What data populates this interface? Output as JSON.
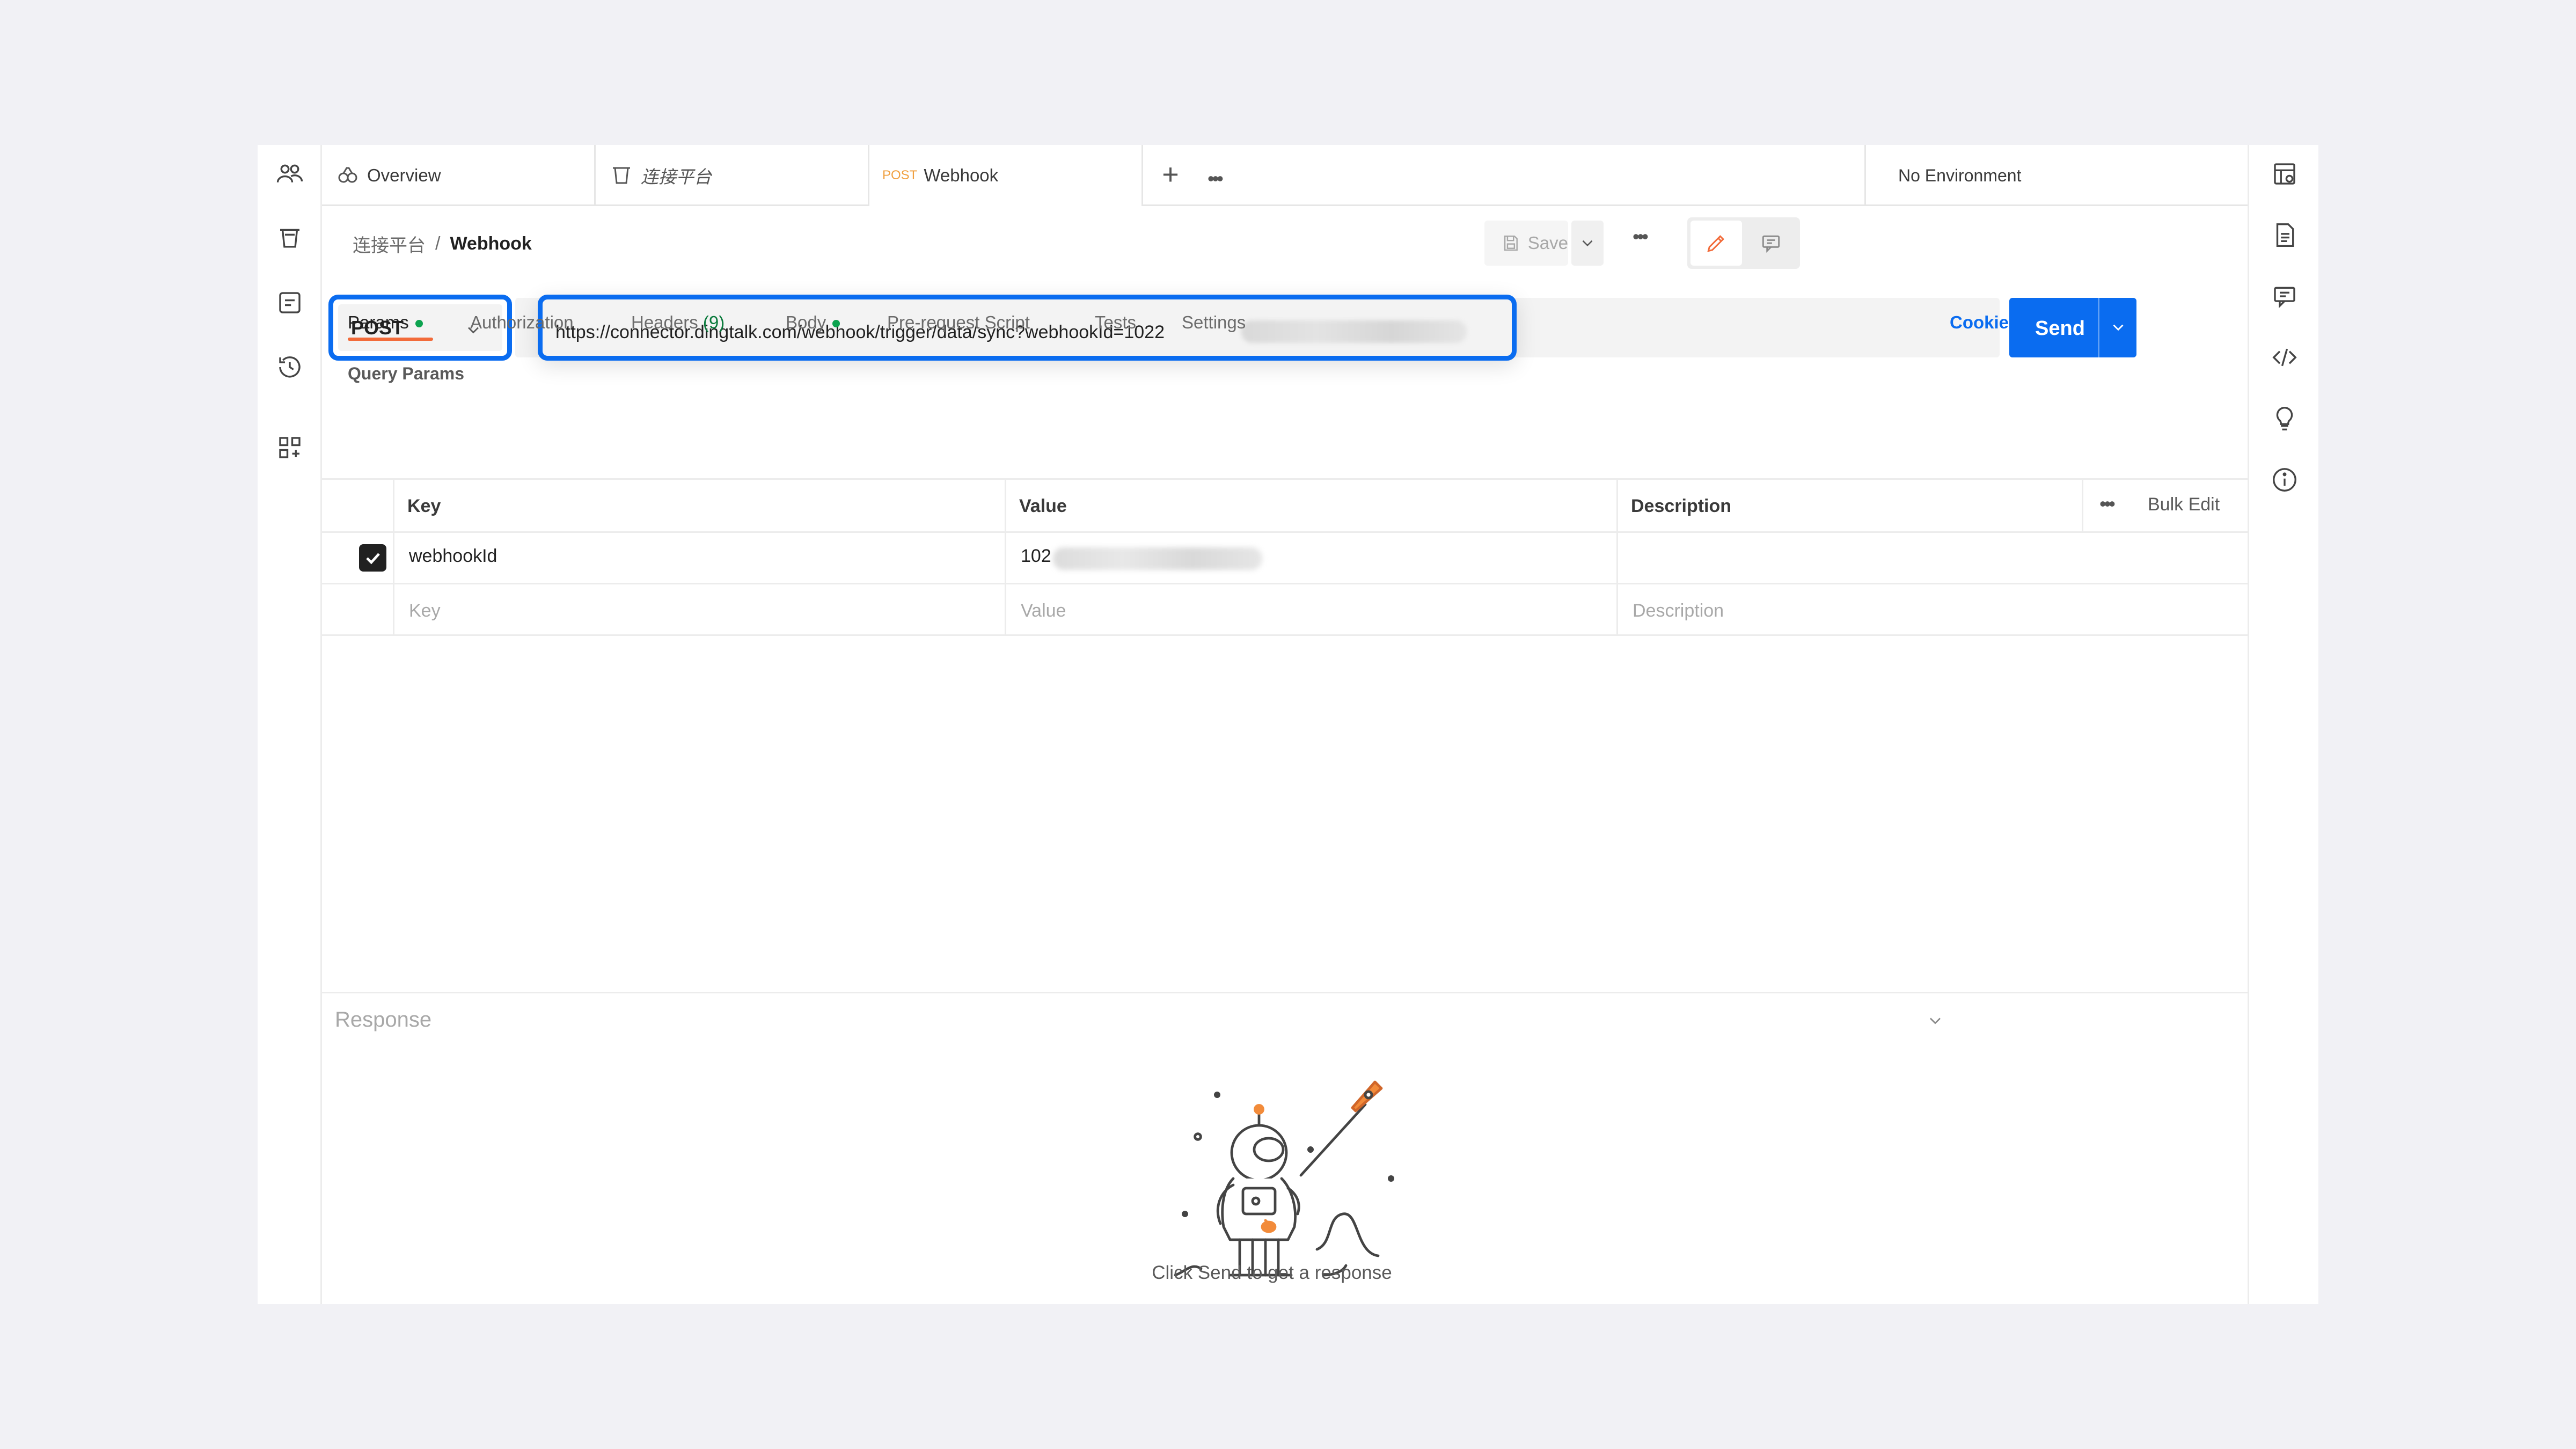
{
  "tabs": {
    "overview": "Overview",
    "collection": "连接平台",
    "request_method": "POST",
    "request_name": "Webhook"
  },
  "environment": {
    "selected": "No Environment"
  },
  "breadcrumb": {
    "collection": "连接平台",
    "separator": "/",
    "request": "Webhook"
  },
  "toolbar": {
    "save_label": "Save"
  },
  "request": {
    "method": "POST",
    "url": "https://connector.dingtalk.com/webhook/trigger/data/sync?webhookId=1022",
    "send_label": "Send"
  },
  "request_tabs": {
    "params": "Params",
    "authorization": "Authorization",
    "headers": "Headers",
    "headers_count": "(9)",
    "body": "Body",
    "prerequest": "Pre-request Script",
    "tests": "Tests",
    "settings": "Settings",
    "cookies": "Cookies"
  },
  "query_params": {
    "title": "Query Params",
    "columns": {
      "key": "Key",
      "value": "Value",
      "description": "Description",
      "bulk_edit": "Bulk Edit"
    },
    "rows": [
      {
        "key": "webhookId",
        "value": "102",
        "checked": true
      }
    ],
    "placeholders": {
      "key": "Key",
      "value": "Value",
      "description": "Description"
    }
  },
  "response": {
    "title": "Response",
    "empty_message": "Click Send to get a response"
  },
  "colors": {
    "accent": "#0a6cf0",
    "tab_underline": "#f26b3a",
    "dot": "#0ca34f",
    "method_label": "#f0a040"
  }
}
